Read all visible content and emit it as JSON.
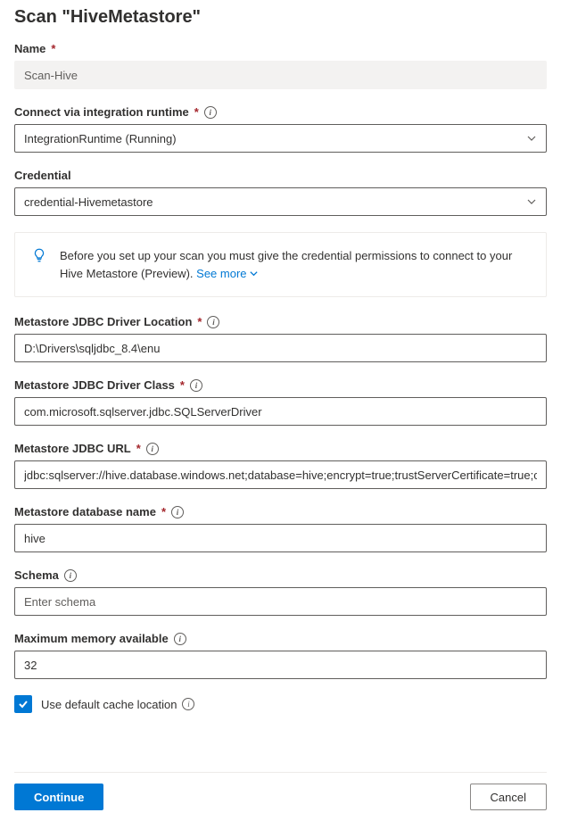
{
  "title": "Scan \"HiveMetastore\"",
  "fields": {
    "name": {
      "label": "Name",
      "value": "Scan-Hive"
    },
    "runtime": {
      "label": "Connect via integration runtime",
      "value": "IntegrationRuntime (Running)"
    },
    "credential": {
      "label": "Credential",
      "value": "credential-Hivemetastore"
    },
    "driverLocation": {
      "label": "Metastore JDBC Driver Location",
      "value": "D:\\Drivers\\sqljdbc_8.4\\enu"
    },
    "driverClass": {
      "label": "Metastore JDBC Driver Class",
      "value": "com.microsoft.sqlserver.jdbc.SQLServerDriver"
    },
    "jdbcUrl": {
      "label": "Metastore JDBC URL",
      "value": "jdbc:sqlserver://hive.database.windows.net;database=hive;encrypt=true;trustServerCertificate=true;create=fal"
    },
    "databaseName": {
      "label": "Metastore database name",
      "value": "hive"
    },
    "schema": {
      "label": "Schema",
      "placeholder": "Enter schema"
    },
    "maxMemory": {
      "label": "Maximum memory available",
      "value": "32"
    },
    "cacheLocation": {
      "label": "Use default cache location"
    }
  },
  "banner": {
    "text": "Before you set up your scan you must give the credential permissions to connect to your Hive Metastore (Preview). ",
    "seeMore": "See more"
  },
  "buttons": {
    "continue": "Continue",
    "cancel": "Cancel"
  }
}
